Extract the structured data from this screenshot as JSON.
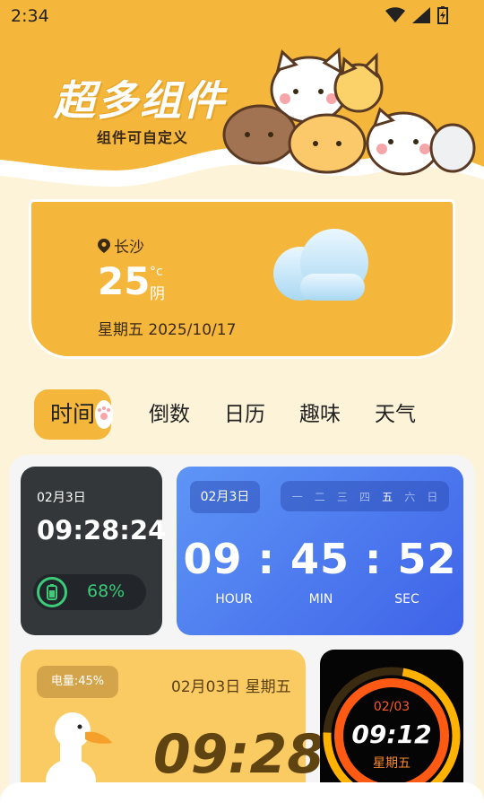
{
  "status_bar": {
    "time": "2:34"
  },
  "hero": {
    "title": "超多组件",
    "subtitle": "组件可自定义"
  },
  "weather": {
    "city": "长沙",
    "temperature": "25",
    "unit": "°c",
    "condition": "阴",
    "date": "星期五 2025/10/17",
    "icon": "cloud-icon"
  },
  "tabs": [
    {
      "label": "时间",
      "active": true
    },
    {
      "label": "倒数"
    },
    {
      "label": "日历"
    },
    {
      "label": "趣味"
    },
    {
      "label": "天气"
    }
  ],
  "widgets": {
    "dark_clock": {
      "date": "02月3日",
      "time": "09:28:24",
      "battery": "68%",
      "battery_fraction": 0.68
    },
    "blue_clock": {
      "date": "02月3日",
      "weekdays": [
        "一",
        "二",
        "三",
        "四",
        "五",
        "六",
        "日"
      ],
      "current_weekday_index": 4,
      "hour": "09",
      "minute": "45",
      "second": "52",
      "separator": ":",
      "hour_label": "HOUR",
      "min_label": "MIN",
      "sec_label": "SEC"
    },
    "duck_clock": {
      "battery": "电量:45%",
      "date": "02月03日 星期五",
      "time": "09:28"
    },
    "ring_clock": {
      "date": "02/03",
      "time": "09:12",
      "weekday": "星期五"
    }
  },
  "colors": {
    "accent": "#f4b73c",
    "background": "#fdf3d8",
    "battery_green": "#3ccb78",
    "blue_start": "#5e95f6",
    "blue_end": "#3f63e8"
  }
}
